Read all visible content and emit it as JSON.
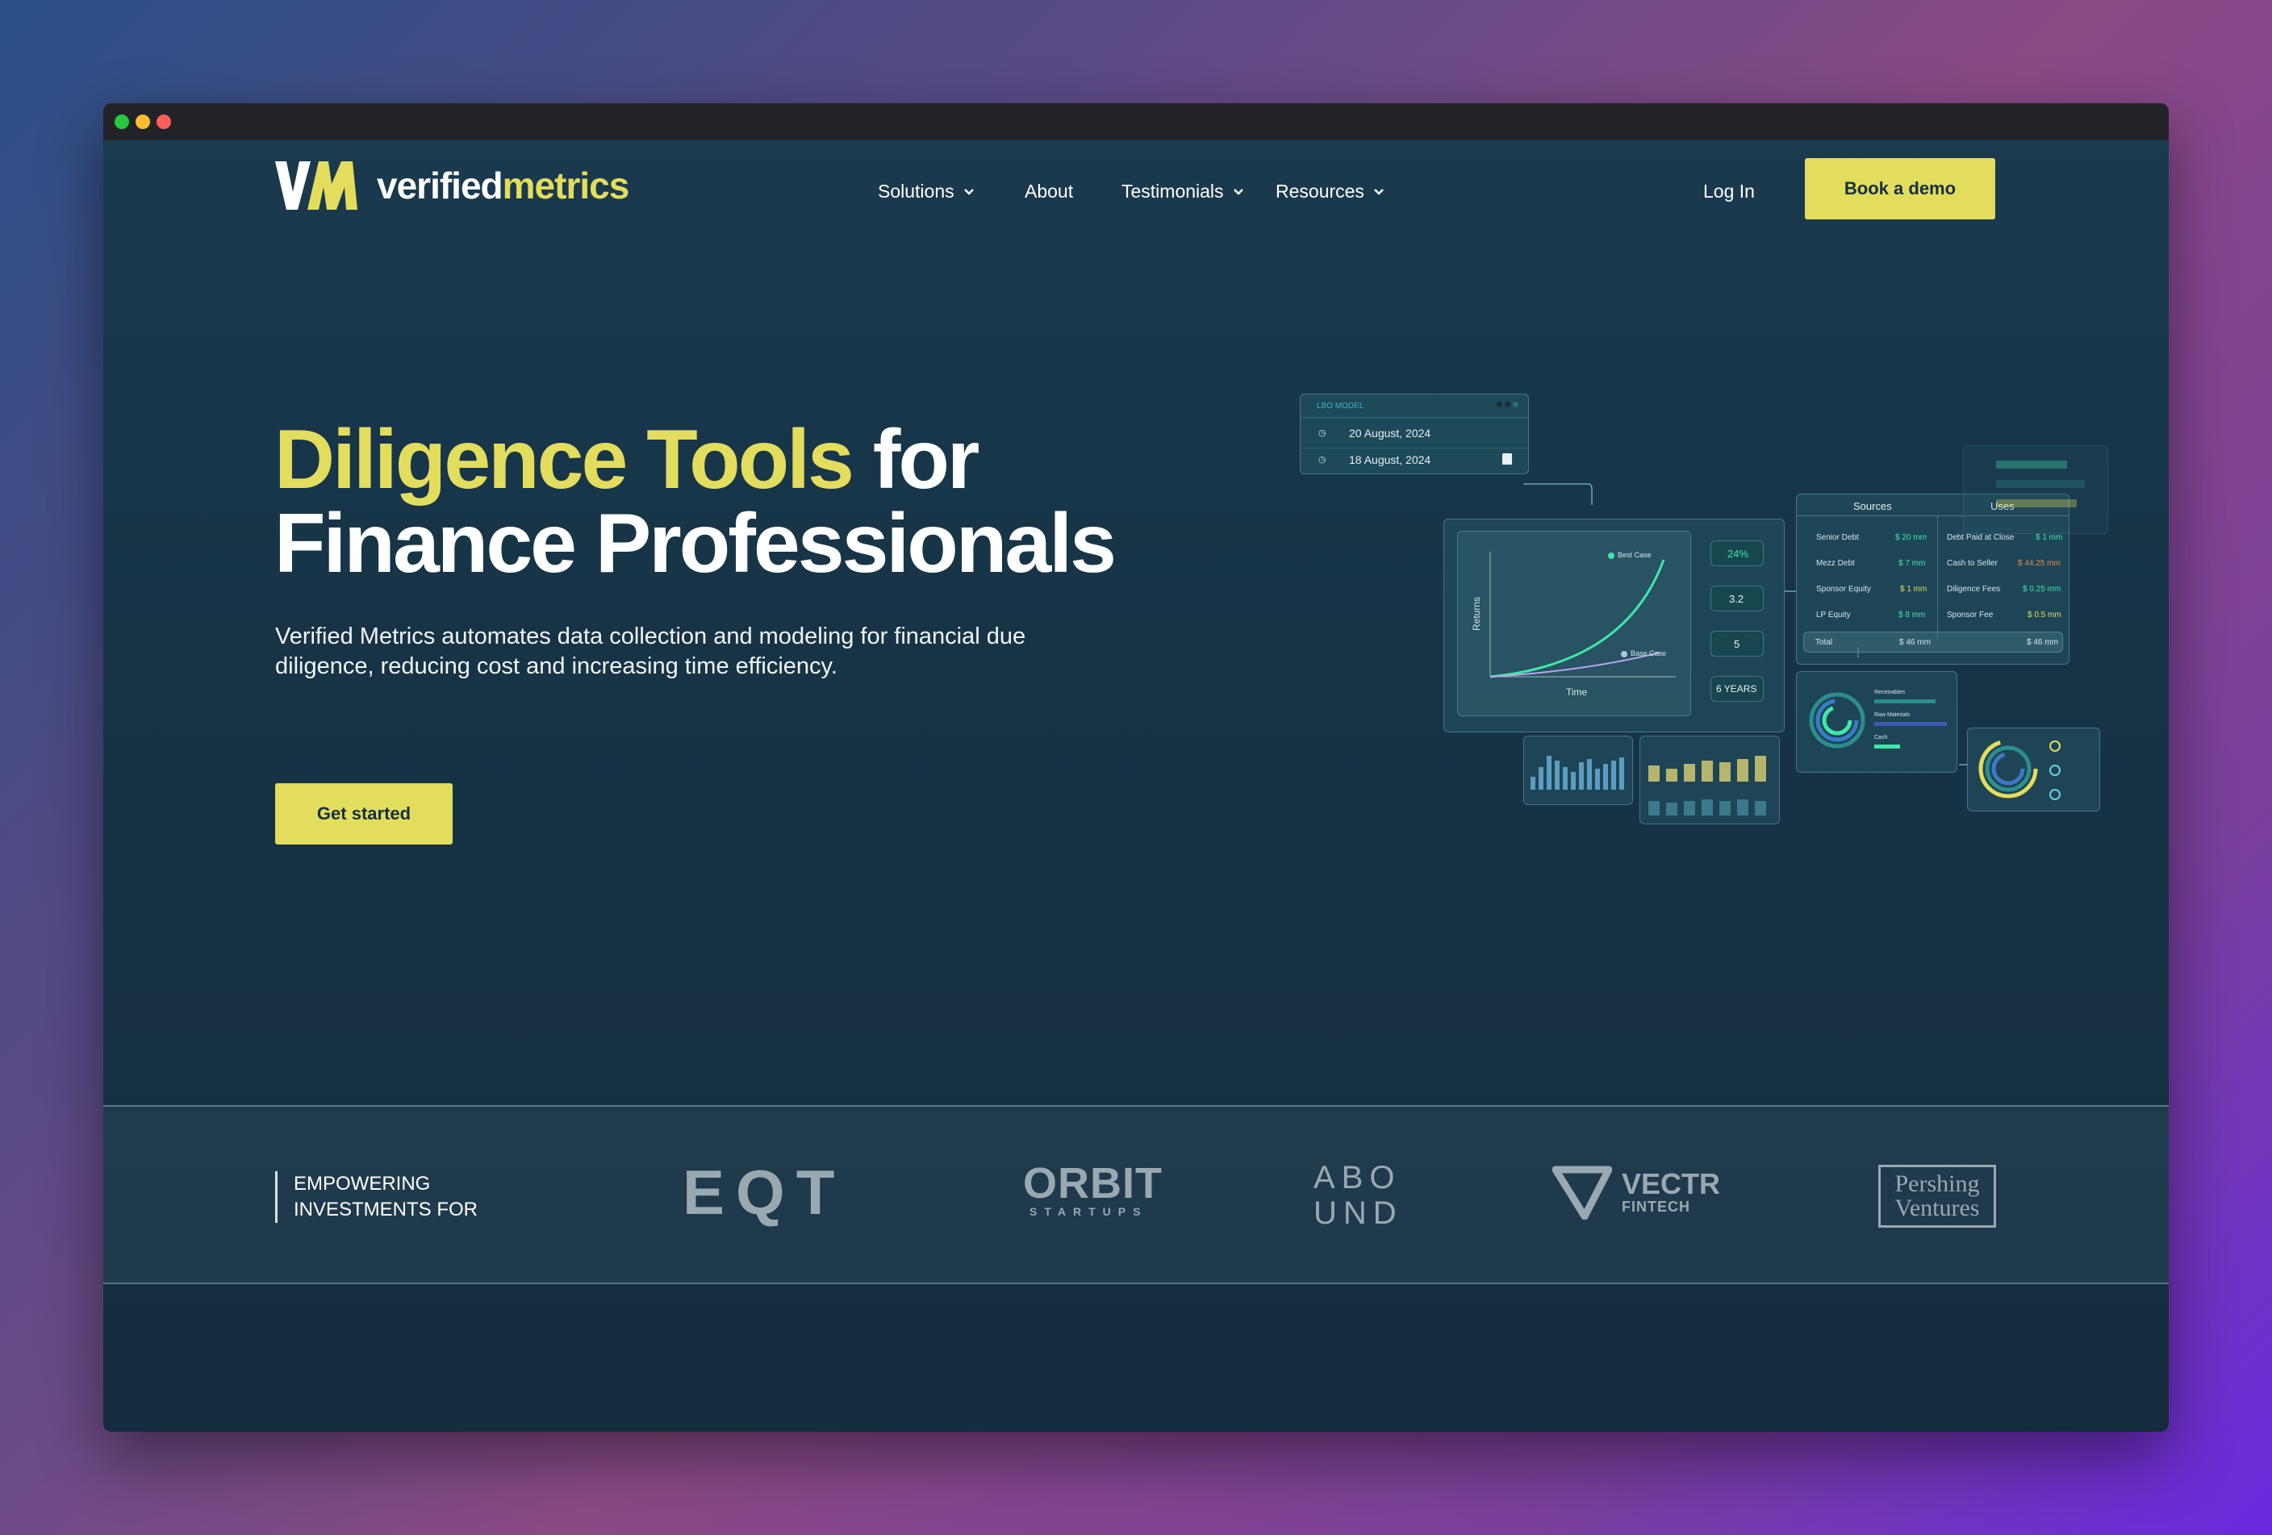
{
  "browser": {
    "dots": [
      "#27c93f",
      "#ffbd2e",
      "#ff5f56"
    ]
  },
  "brand": {
    "mark": "VM",
    "name_part1": "verified",
    "name_part2": "metrics",
    "accent": "#e3dd5d"
  },
  "nav": {
    "items": [
      {
        "label": "Solutions",
        "has_dropdown": true
      },
      {
        "label": "About",
        "has_dropdown": false
      },
      {
        "label": "Testimonials",
        "has_dropdown": true
      },
      {
        "label": "Resources",
        "has_dropdown": true
      }
    ],
    "login": "Log In",
    "demo": "Book a demo"
  },
  "hero": {
    "title_highlight": "Diligence Tools",
    "title_rest1": " for",
    "title_line2": "Finance Professionals",
    "description": "Verified Metrics automates data collection and modeling for financial due diligence, reducing cost and increasing time efficiency.",
    "cta": "Get started"
  },
  "mockup": {
    "lbo_title": "LBO MODEL",
    "date1": "20 August, 2024",
    "date2": "18 August, 2024",
    "chart": {
      "ylabel": "Returns",
      "xlabel": "Time",
      "best": "Best Case",
      "base": "Base Case"
    },
    "metrics": [
      "24%",
      "3.2",
      "5",
      "6 YEARS"
    ],
    "sources_title": "Sources",
    "uses_title": "Uses",
    "sources_rows": [
      {
        "label": "Senior Debt",
        "value": "$ 20 mm"
      },
      {
        "label": "Mezz Debt",
        "value": "$ 7 mm"
      },
      {
        "label": "Sponsor Equity",
        "value": "$ 1 mm"
      },
      {
        "label": "LP Equity",
        "value": "$ 8 mm"
      }
    ],
    "uses_rows": [
      {
        "label": "Debt Paid at Close",
        "value": "$ 1 mm"
      },
      {
        "label": "Cash to Seller",
        "value": "$ 44.25 mm"
      },
      {
        "label": "Diligence Fees",
        "value": "$ 0.25 mm"
      },
      {
        "label": "Sponsor Fee",
        "value": "$ 0.5 mm"
      }
    ],
    "total_label": "Total",
    "total_sources": "$ 46 mm",
    "total_uses": "$ 46 mm",
    "ring_labels": [
      "Receivables",
      "Raw Materials",
      "Cash"
    ]
  },
  "partners": {
    "label_line1": "EMPOWERING",
    "label_line2": "INVESTMENTS FOR",
    "logos": [
      "EQT",
      "ORBIT",
      "STARTUPS",
      "ABO",
      "UND",
      "VECTR",
      "FINTECH",
      "Pershing",
      "Ventures"
    ]
  }
}
